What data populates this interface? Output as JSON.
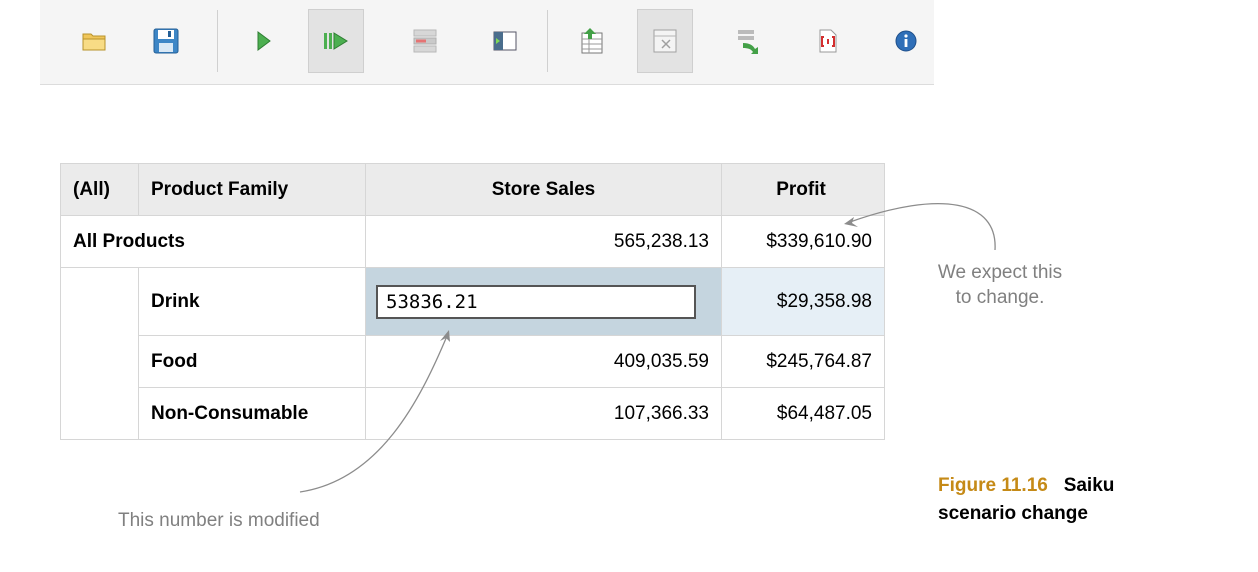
{
  "toolbar": {
    "buttons": [
      {
        "name": "open-query-icon",
        "state": "normal"
      },
      {
        "name": "save-query-icon",
        "state": "normal"
      },
      {
        "name": "run-query-icon",
        "state": "normal"
      },
      {
        "name": "automatic-execution-icon",
        "state": "active"
      },
      {
        "name": "toggle-fields-icon",
        "state": "normal"
      },
      {
        "name": "toggle-sidebar-icon",
        "state": "normal"
      },
      {
        "name": "non-empty-icon",
        "state": "normal"
      },
      {
        "name": "swap-axis-icon",
        "state": "active"
      },
      {
        "name": "drill-through-icon",
        "state": "normal"
      },
      {
        "name": "show-mdx-icon",
        "state": "normal"
      },
      {
        "name": "info-icon",
        "state": "normal"
      }
    ]
  },
  "table": {
    "headers": [
      "(All)",
      "Product Family",
      "Store Sales",
      "Profit"
    ],
    "total_row": {
      "label": "All Products",
      "sales": "565,238.13",
      "profit": "$339,610.90"
    },
    "rows": [
      {
        "family": "Drink",
        "sales": "53836.21",
        "profit": "$29,358.98",
        "editing": true
      },
      {
        "family": "Food",
        "sales": "409,035.59",
        "profit": "$245,764.87",
        "editing": false
      },
      {
        "family": "Non-Consumable",
        "sales": "107,366.33",
        "profit": "$64,487.05",
        "editing": false
      }
    ]
  },
  "annotations": {
    "expect_line1": "We expect this",
    "expect_line2": "to change.",
    "modified": "This number is modified"
  },
  "caption": {
    "number": "Figure 11.16",
    "title_line1": "Saiku",
    "title_line2": "scenario change"
  },
  "colors": {
    "edit_cell": "#c5d5df",
    "highlight_cell": "#e6eff6",
    "caption_number": "#c58a17",
    "annotation_text": "#808080"
  }
}
